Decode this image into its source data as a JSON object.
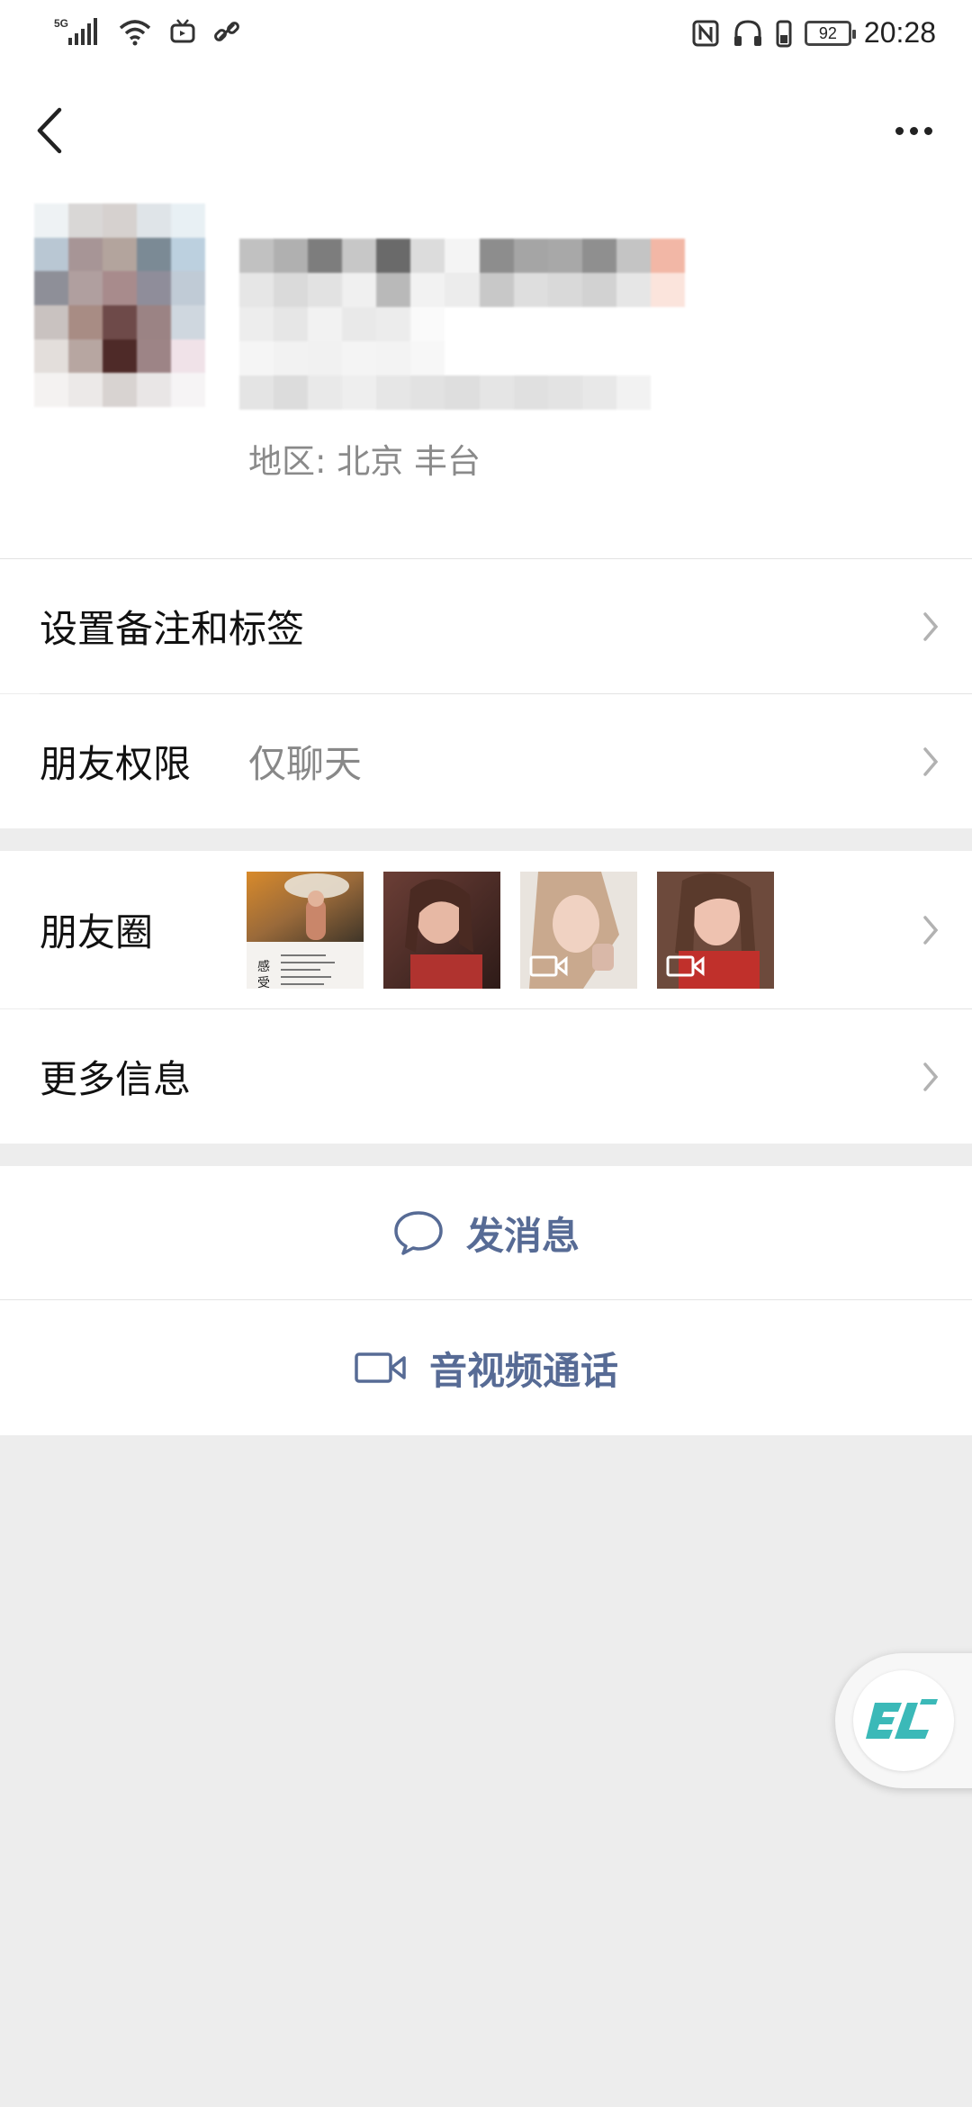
{
  "status_bar": {
    "network": "5G",
    "battery": "92",
    "time": "20:28"
  },
  "profile": {
    "region_label": "地区:",
    "region_value": "北京  丰台"
  },
  "rows": {
    "remark_label": "设置备注和标签",
    "permission_label": "朋友权限",
    "permission_value": "仅聊天",
    "moments_label": "朋友圈",
    "more_info_label": "更多信息"
  },
  "moments_thumbnails": [
    {
      "name": "umbrella-photo",
      "has_video": false,
      "caption_glyph": "感受"
    },
    {
      "name": "portrait-photo-1",
      "has_video": false
    },
    {
      "name": "portrait-photo-2",
      "has_video": true
    },
    {
      "name": "portrait-photo-3",
      "has_video": true
    }
  ],
  "actions": {
    "message_label": "发消息",
    "call_label": "音视频通话"
  },
  "icons": [
    "back-arrow-icon",
    "more-dots-icon",
    "chevron-right-icon",
    "chat-bubble-icon",
    "video-camera-icon",
    "floating-assistant-icon"
  ],
  "colors": {
    "action_text": "#576b95",
    "background": "#ededed",
    "floating_logo": "#3bb9b8"
  }
}
